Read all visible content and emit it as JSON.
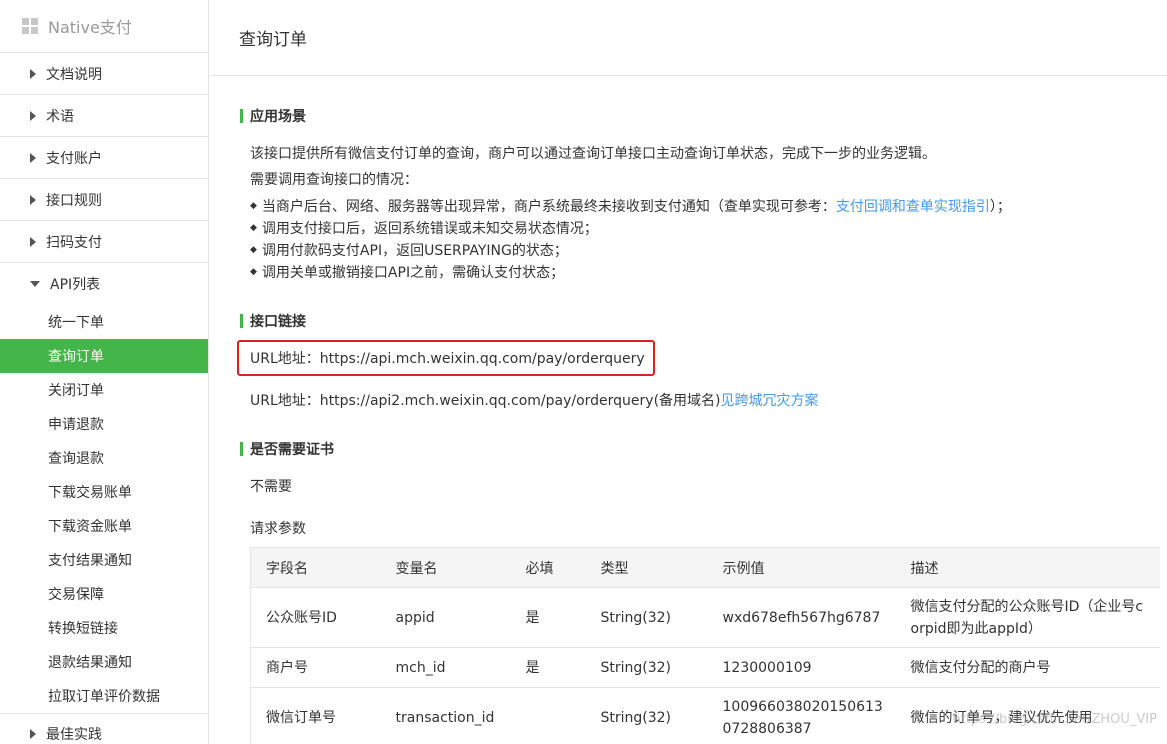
{
  "sidebar": {
    "title": "Native支付",
    "groups": [
      {
        "label": "文档说明"
      },
      {
        "label": "术语"
      },
      {
        "label": "支付账户"
      },
      {
        "label": "接口规则"
      },
      {
        "label": "扫码支付"
      }
    ],
    "api_group": {
      "label": "API列表",
      "items": [
        {
          "label": "统一下单"
        },
        {
          "label": "查询订单"
        },
        {
          "label": "关闭订单"
        },
        {
          "label": "申请退款"
        },
        {
          "label": "查询退款"
        },
        {
          "label": "下载交易账单"
        },
        {
          "label": "下载资金账单"
        },
        {
          "label": "支付结果通知"
        },
        {
          "label": "交易保障"
        },
        {
          "label": "转换短链接"
        },
        {
          "label": "退款结果通知"
        },
        {
          "label": "拉取订单评价数据"
        }
      ],
      "active_index": 1
    },
    "last_group": {
      "label": "最佳实践"
    }
  },
  "page": {
    "title": "查询订单",
    "scenario": {
      "heading": "应用场景",
      "intro": "该接口提供所有微信支付订单的查询，商户可以通过查询订单接口主动查询订单状态，完成下一步的业务逻辑。",
      "need_label": "需要调用查询接口的情况：",
      "bullet1_text": "当商户后台、网络、服务器等出现异常，商户系统最终未接收到支付通知（查单实现可参考：",
      "bullet1_link": "支付回调和查单实现指引",
      "bullet1_tail": "）；",
      "bullet2": "调用支付接口后，返回系统错误或未知交易状态情况；",
      "bullet3": "调用付款码支付API，返回USERPAYING的状态；",
      "bullet4": "调用关单或撤销接口API之前，需确认支付状态；"
    },
    "link_section": {
      "heading": "接口链接",
      "url1": "URL地址：https://api.mch.weixin.qq.com/pay/orderquery",
      "url2": "URL地址：https://api2.mch.weixin.qq.com/pay/orderquery(备用域名)",
      "url2_link": "见跨城冗灾方案"
    },
    "cert_section": {
      "heading": "是否需要证书",
      "value": "不需要"
    },
    "request_params_label": "请求参数",
    "table": {
      "headers": [
        "字段名",
        "变量名",
        "必填",
        "类型",
        "示例值",
        "描述"
      ],
      "rows": [
        [
          "公众账号ID",
          "appid",
          "是",
          "String(32)",
          "wxd678efh567hg6787",
          "微信支付分配的公众账号ID（企业号corpid即为此appId）"
        ],
        [
          "商户号",
          "mch_id",
          "是",
          "String(32)",
          "1230000109",
          "微信支付分配的商户号"
        ],
        [
          "微信订单号",
          "transaction_id",
          "",
          "String(32)",
          "1009660380201506130728806387",
          "微信的订单号，建议优先使用"
        ]
      ]
    },
    "watermark": "https://blog.csdn.net/ZHOU_VIP"
  },
  "colors": {
    "accent": "#44b549",
    "link": "#459ae9",
    "highlight_border": "#e02020"
  }
}
